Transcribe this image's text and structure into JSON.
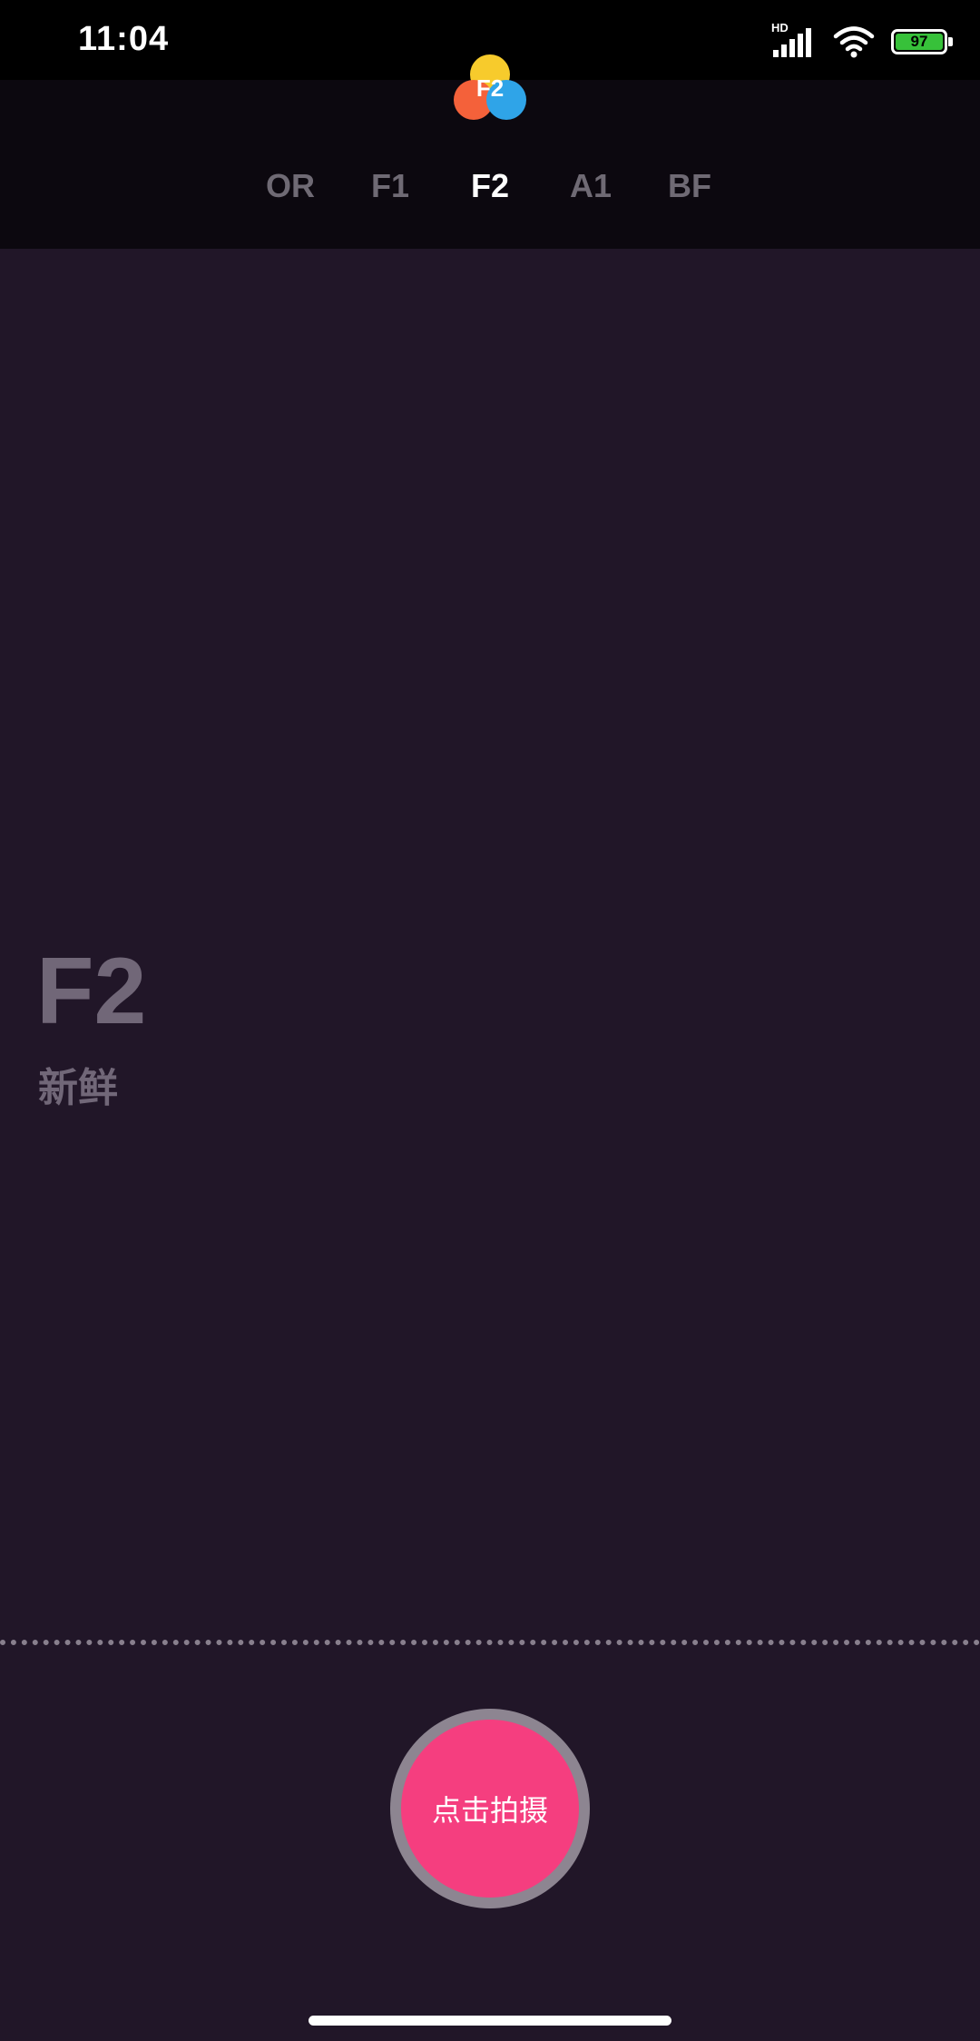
{
  "status_bar": {
    "time": "11:04",
    "network_label": "HD",
    "battery_level": "97",
    "battery_color": "#37c13a"
  },
  "logo": {
    "label": "F2",
    "colors": [
      "#f7cb2c",
      "#f4613a",
      "#2fa4e8"
    ]
  },
  "filter_tabs": [
    {
      "label": "OR",
      "active": false
    },
    {
      "label": "F1",
      "active": false
    },
    {
      "label": "F2",
      "active": true
    },
    {
      "label": "A1",
      "active": false
    },
    {
      "label": "BF",
      "active": false
    }
  ],
  "current_filter": {
    "name": "F2",
    "description": "新鲜"
  },
  "shutter": {
    "label": "点击拍摄",
    "color": "#f53e7f"
  }
}
